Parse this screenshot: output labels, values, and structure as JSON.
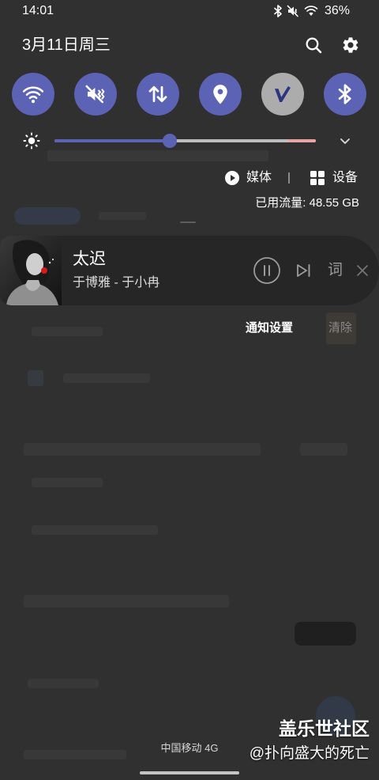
{
  "status_bar": {
    "time": "14:01",
    "battery": "36%",
    "icons": [
      "bluetooth-icon",
      "mute-icon",
      "wifi-icon"
    ]
  },
  "header": {
    "date": "3月11日周三",
    "search_icon": "search-icon",
    "settings_icon": "gear-icon"
  },
  "quick_settings": {
    "tiles": [
      {
        "icon": "wifi-icon",
        "active": true
      },
      {
        "icon": "mute-icon",
        "active": true
      },
      {
        "icon": "mobile-data-icon",
        "active": true
      },
      {
        "icon": "location-icon",
        "active": true
      },
      {
        "icon": "v-logo-icon",
        "active": false
      },
      {
        "icon": "bluetooth-icon",
        "active": true
      }
    ]
  },
  "brightness": {
    "icon": "sun-icon",
    "level": 0.44,
    "expand_icon": "chevron-down-icon"
  },
  "media_device_bar": {
    "media_icon": "play-circle-icon",
    "media_label": "媒体",
    "devices_icon": "devices-grid-icon",
    "devices_label": "设备"
  },
  "data_usage": "已用流量: 48.55 GB",
  "media_notification": {
    "title": "太迟",
    "subtitle": "于博雅 - 于小冉",
    "controls": {
      "play_pause_icon": "pause-icon",
      "next_icon": "skip-next-icon",
      "lyrics_label": "词",
      "close_icon": "close-icon"
    }
  },
  "notification_actions": {
    "settings_label": "通知设置",
    "clear_label": "清除"
  },
  "footer": {
    "carrier": "中国移动 4G"
  },
  "watermark": {
    "line1": "盖乐世社区",
    "line2": "@扑向盛大的死亡"
  },
  "colors": {
    "tile_active": "#5c63b4",
    "tile_inactive": "#acacac",
    "slider_fill": "#5c63b4",
    "slider_track": "#bdbdbd",
    "slider_extra": "#e8a3a3",
    "card_background": "#262626",
    "panel_background": "#303030"
  }
}
